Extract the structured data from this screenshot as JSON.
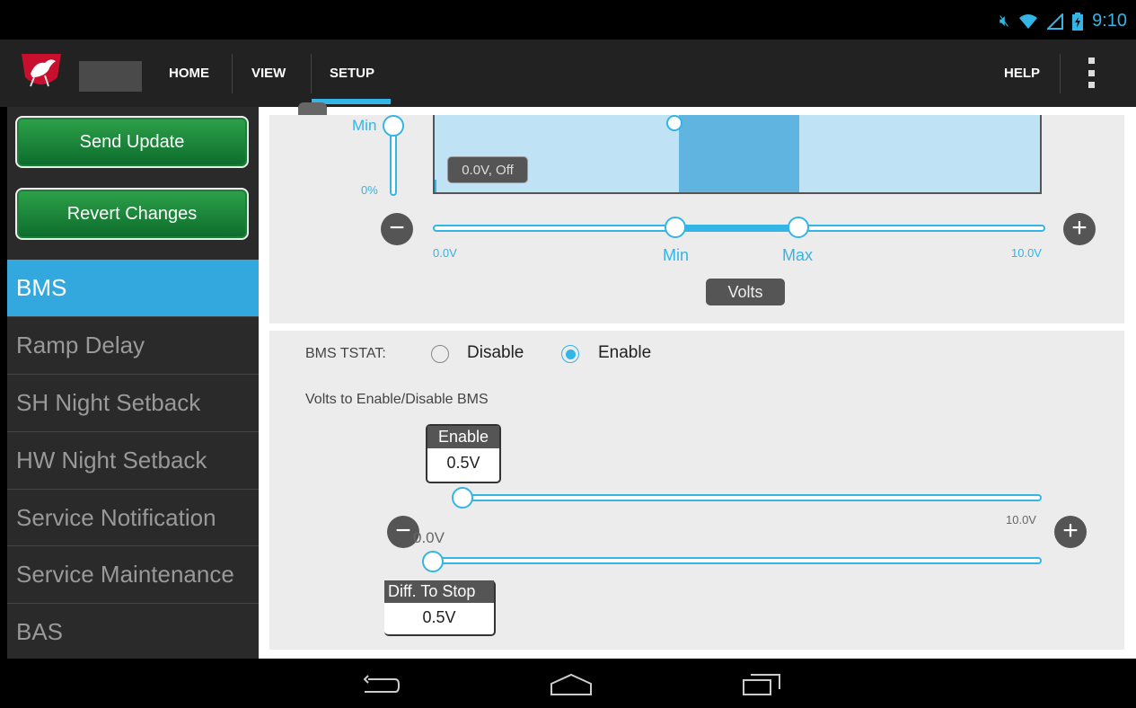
{
  "status_bar": {
    "time": "9:10",
    "icons": [
      "mute-icon",
      "wifi-icon",
      "signal-icon",
      "battery-icon"
    ]
  },
  "action_bar": {
    "tabs": [
      {
        "label": "HOME"
      },
      {
        "label": "VIEW"
      },
      {
        "label": "SETUP"
      }
    ],
    "help_label": "HELP",
    "active_tab": "SETUP"
  },
  "sidebar": {
    "send_update": "Send Update",
    "revert_changes": "Revert Changes",
    "items": [
      {
        "label": "BMS"
      },
      {
        "label": "Ramp Delay"
      },
      {
        "label": "SH Night Setback"
      },
      {
        "label": "HW Night Setback"
      },
      {
        "label": "Service Notification"
      },
      {
        "label": "Service Maintenance"
      },
      {
        "label": "BAS"
      }
    ],
    "active_item": "BMS"
  },
  "chart_panel": {
    "vertical_slider": {
      "top_label": "Min",
      "bottom_label": "0%"
    },
    "graph_tooltip": "0.0V, Off",
    "range_slider": {
      "min_label": "0.0V",
      "max_label": "10.0V",
      "thumb_min_label": "Min",
      "thumb_max_label": "Max",
      "min_value": 4.0,
      "max_value": 6.0,
      "range": [
        0,
        10
      ]
    },
    "unit_button": "Volts"
  },
  "bms_panel": {
    "tstat_label": "BMS TSTAT:",
    "option_disable": "Disable",
    "option_enable": "Enable",
    "selected": "Enable",
    "volts_heading": "Volts to Enable/Disable BMS",
    "enable_slider": {
      "title": "Enable",
      "value": "0.5V",
      "max_label": "10.0V",
      "value_fraction": 0.05
    },
    "stop_slider": {
      "title": "Diff. To Stop",
      "value": "0.5V",
      "min_label": "0.0V",
      "value_fraction": 0.0
    }
  },
  "colors": {
    "accent": "#33b5e5",
    "green": "#1b8a3b",
    "sidebar_active": "#33a8df"
  }
}
